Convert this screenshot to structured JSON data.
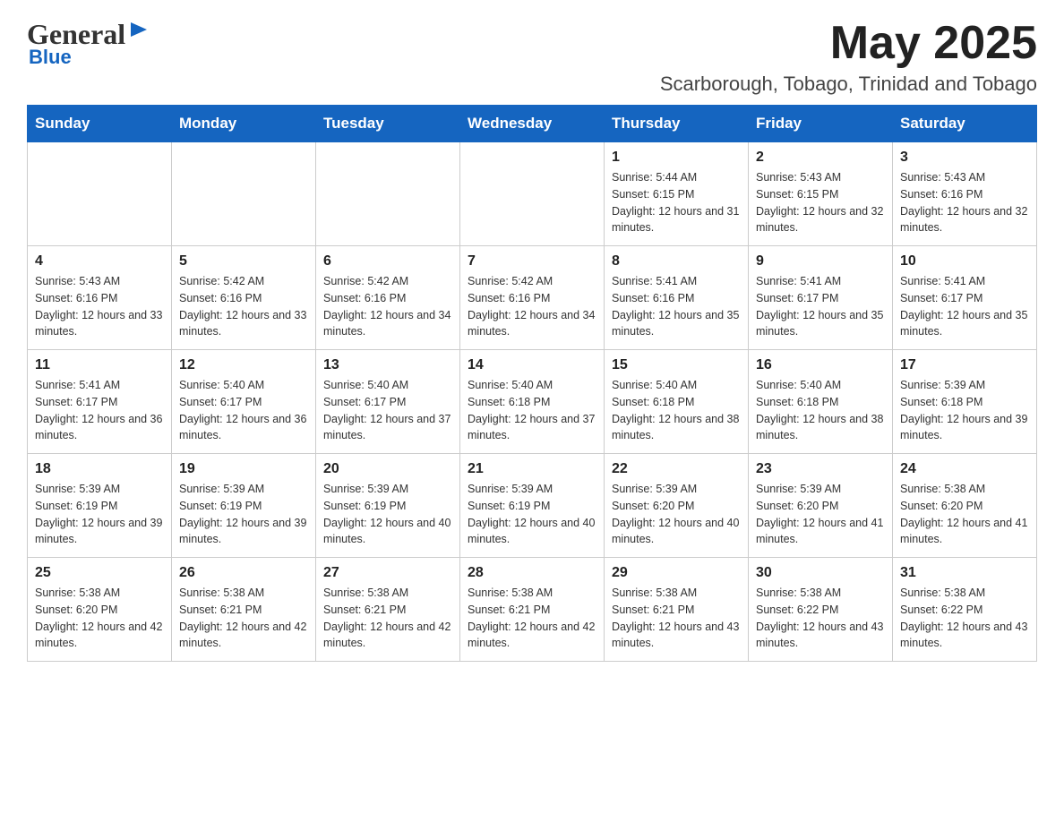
{
  "header": {
    "month_year": "May 2025",
    "location": "Scarborough, Tobago, Trinidad and Tobago",
    "logo_general": "General",
    "logo_blue": "Blue"
  },
  "days_of_week": [
    "Sunday",
    "Monday",
    "Tuesday",
    "Wednesday",
    "Thursday",
    "Friday",
    "Saturday"
  ],
  "weeks": [
    [
      {
        "day": "",
        "info": ""
      },
      {
        "day": "",
        "info": ""
      },
      {
        "day": "",
        "info": ""
      },
      {
        "day": "",
        "info": ""
      },
      {
        "day": "1",
        "info": "Sunrise: 5:44 AM\nSunset: 6:15 PM\nDaylight: 12 hours and 31 minutes."
      },
      {
        "day": "2",
        "info": "Sunrise: 5:43 AM\nSunset: 6:15 PM\nDaylight: 12 hours and 32 minutes."
      },
      {
        "day": "3",
        "info": "Sunrise: 5:43 AM\nSunset: 6:16 PM\nDaylight: 12 hours and 32 minutes."
      }
    ],
    [
      {
        "day": "4",
        "info": "Sunrise: 5:43 AM\nSunset: 6:16 PM\nDaylight: 12 hours and 33 minutes."
      },
      {
        "day": "5",
        "info": "Sunrise: 5:42 AM\nSunset: 6:16 PM\nDaylight: 12 hours and 33 minutes."
      },
      {
        "day": "6",
        "info": "Sunrise: 5:42 AM\nSunset: 6:16 PM\nDaylight: 12 hours and 34 minutes."
      },
      {
        "day": "7",
        "info": "Sunrise: 5:42 AM\nSunset: 6:16 PM\nDaylight: 12 hours and 34 minutes."
      },
      {
        "day": "8",
        "info": "Sunrise: 5:41 AM\nSunset: 6:16 PM\nDaylight: 12 hours and 35 minutes."
      },
      {
        "day": "9",
        "info": "Sunrise: 5:41 AM\nSunset: 6:17 PM\nDaylight: 12 hours and 35 minutes."
      },
      {
        "day": "10",
        "info": "Sunrise: 5:41 AM\nSunset: 6:17 PM\nDaylight: 12 hours and 35 minutes."
      }
    ],
    [
      {
        "day": "11",
        "info": "Sunrise: 5:41 AM\nSunset: 6:17 PM\nDaylight: 12 hours and 36 minutes."
      },
      {
        "day": "12",
        "info": "Sunrise: 5:40 AM\nSunset: 6:17 PM\nDaylight: 12 hours and 36 minutes."
      },
      {
        "day": "13",
        "info": "Sunrise: 5:40 AM\nSunset: 6:17 PM\nDaylight: 12 hours and 37 minutes."
      },
      {
        "day": "14",
        "info": "Sunrise: 5:40 AM\nSunset: 6:18 PM\nDaylight: 12 hours and 37 minutes."
      },
      {
        "day": "15",
        "info": "Sunrise: 5:40 AM\nSunset: 6:18 PM\nDaylight: 12 hours and 38 minutes."
      },
      {
        "day": "16",
        "info": "Sunrise: 5:40 AM\nSunset: 6:18 PM\nDaylight: 12 hours and 38 minutes."
      },
      {
        "day": "17",
        "info": "Sunrise: 5:39 AM\nSunset: 6:18 PM\nDaylight: 12 hours and 39 minutes."
      }
    ],
    [
      {
        "day": "18",
        "info": "Sunrise: 5:39 AM\nSunset: 6:19 PM\nDaylight: 12 hours and 39 minutes."
      },
      {
        "day": "19",
        "info": "Sunrise: 5:39 AM\nSunset: 6:19 PM\nDaylight: 12 hours and 39 minutes."
      },
      {
        "day": "20",
        "info": "Sunrise: 5:39 AM\nSunset: 6:19 PM\nDaylight: 12 hours and 40 minutes."
      },
      {
        "day": "21",
        "info": "Sunrise: 5:39 AM\nSunset: 6:19 PM\nDaylight: 12 hours and 40 minutes."
      },
      {
        "day": "22",
        "info": "Sunrise: 5:39 AM\nSunset: 6:20 PM\nDaylight: 12 hours and 40 minutes."
      },
      {
        "day": "23",
        "info": "Sunrise: 5:39 AM\nSunset: 6:20 PM\nDaylight: 12 hours and 41 minutes."
      },
      {
        "day": "24",
        "info": "Sunrise: 5:38 AM\nSunset: 6:20 PM\nDaylight: 12 hours and 41 minutes."
      }
    ],
    [
      {
        "day": "25",
        "info": "Sunrise: 5:38 AM\nSunset: 6:20 PM\nDaylight: 12 hours and 42 minutes."
      },
      {
        "day": "26",
        "info": "Sunrise: 5:38 AM\nSunset: 6:21 PM\nDaylight: 12 hours and 42 minutes."
      },
      {
        "day": "27",
        "info": "Sunrise: 5:38 AM\nSunset: 6:21 PM\nDaylight: 12 hours and 42 minutes."
      },
      {
        "day": "28",
        "info": "Sunrise: 5:38 AM\nSunset: 6:21 PM\nDaylight: 12 hours and 42 minutes."
      },
      {
        "day": "29",
        "info": "Sunrise: 5:38 AM\nSunset: 6:21 PM\nDaylight: 12 hours and 43 minutes."
      },
      {
        "day": "30",
        "info": "Sunrise: 5:38 AM\nSunset: 6:22 PM\nDaylight: 12 hours and 43 minutes."
      },
      {
        "day": "31",
        "info": "Sunrise: 5:38 AM\nSunset: 6:22 PM\nDaylight: 12 hours and 43 minutes."
      }
    ]
  ]
}
